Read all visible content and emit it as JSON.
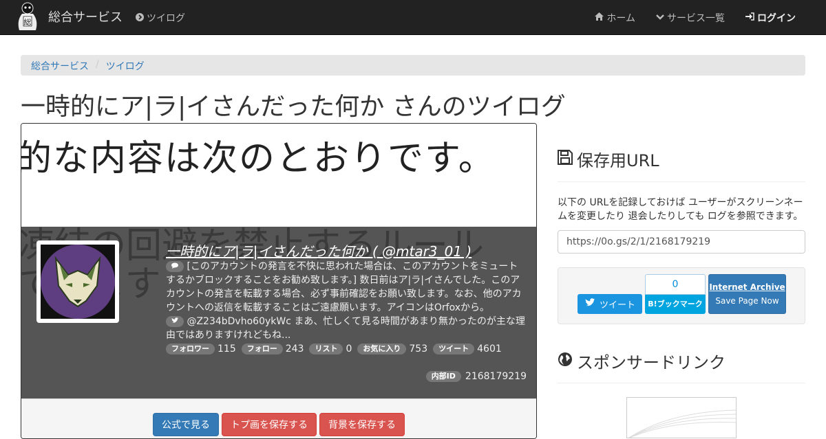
{
  "navbar": {
    "brand": "総合サービス",
    "service_link": "ツイログ",
    "home": "ホーム",
    "services": "サービス一覧",
    "login": "ログイン"
  },
  "breadcrumb": [
    "総合サービス",
    "ツイログ"
  ],
  "page_title": "一時的にア|ラ|イさんだった何か さんのツイログ",
  "banner_text": "的な内容は次のとおりです。",
  "profile": {
    "bg_text_1": "凍結の回避を禁止するルール",
    "bg_text_2": "てきます",
    "name": "一時的にア|ラ|イさんだった何か ( @mtar3_01 )",
    "description": "[このアカウントの発言を不快に思われた場合は、このアカウントをミュートするかブロックすることをお勧め致します。] 数日前はア|ラ|イさんでした。このアカウントの発言を転載する場合、必ず事前確認をお願い致します。なお、他のアカウントへの返信を転載することはご遠慮願います。アイコンはOrfoxから。",
    "last_tweet": "@Z234bDvho60ykWc まあ、忙しくて見る時間があまり無かったのが主な理由ではありますけれどもね...",
    "stats": [
      {
        "label": "フォロワー",
        "value": "115"
      },
      {
        "label": "フォロー",
        "value": "243"
      },
      {
        "label": "リスト",
        "value": "0"
      },
      {
        "label": "お気に入り",
        "value": "753"
      },
      {
        "label": "ツイート",
        "value": "4601"
      }
    ],
    "internal_id_label": "内部ID",
    "internal_id": "2168179219"
  },
  "buttons": {
    "official": "公式で見る",
    "save_top": "トプ画を保存する",
    "save_bg": "背景を保存する"
  },
  "sidebar": {
    "save_url_heading": "保存用URL",
    "save_url_desc": "以下の URLを記録しておけば ユーザーがスクリーンネームを変更したり 退会したりしても ログを参照できます。",
    "url_value": "https://0o.gs/2/1/2168179219",
    "tweet_label": "ツイート",
    "hatena_count": "0",
    "hatena_label": "B!ブックマーク",
    "ia_title": "Internet Archive",
    "ia_action": "Save Page Now",
    "sponsor_heading": "スポンサードリンク"
  },
  "colors": {
    "navbar_bg": "#222222",
    "primary": "#337ab7",
    "danger": "#d9534f",
    "twitter": "#1b95e0",
    "hatena": "#00a4de"
  }
}
